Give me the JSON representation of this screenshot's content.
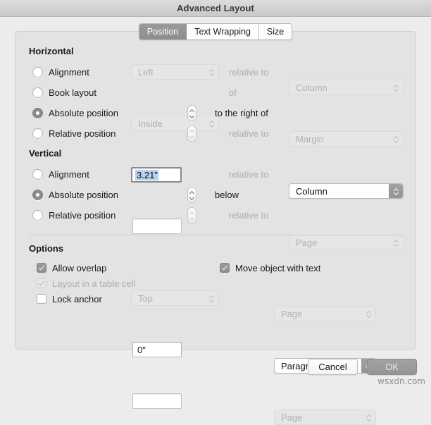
{
  "window": {
    "title": "Advanced Layout"
  },
  "tabs": [
    {
      "label": "Position",
      "active": true
    },
    {
      "label": "Text Wrapping",
      "active": false
    },
    {
      "label": "Size",
      "active": false
    }
  ],
  "horizontal": {
    "title": "Horizontal",
    "rows": [
      {
        "radio_label": "Alignment",
        "selected": false,
        "control_type": "popup",
        "control_value": "Left",
        "control_enabled": false,
        "relation_label": "relative to",
        "relation_enabled": false,
        "target_value": "Column",
        "target_enabled": false
      },
      {
        "radio_label": "Book layout",
        "selected": false,
        "control_type": "popup",
        "control_value": "Inside",
        "control_enabled": false,
        "relation_label": "of",
        "relation_enabled": false,
        "target_value": "Margin",
        "target_enabled": false
      },
      {
        "radio_label": "Absolute position",
        "selected": true,
        "control_type": "field",
        "control_value": "3.21\"",
        "control_enabled": true,
        "relation_label": "to the right of",
        "relation_enabled": true,
        "target_value": "Column",
        "target_enabled": true
      },
      {
        "radio_label": "Relative position",
        "selected": false,
        "control_type": "field",
        "control_value": "",
        "control_enabled": false,
        "relation_label": "relative to",
        "relation_enabled": false,
        "target_value": "Page",
        "target_enabled": false
      }
    ]
  },
  "vertical": {
    "title": "Vertical",
    "rows": [
      {
        "radio_label": "Alignment",
        "selected": false,
        "control_type": "popup",
        "control_value": "Top",
        "control_enabled": false,
        "relation_label": "relative to",
        "relation_enabled": false,
        "target_value": "Page",
        "target_enabled": false
      },
      {
        "radio_label": "Absolute position",
        "selected": true,
        "control_type": "field",
        "control_value": "0\"",
        "control_enabled": true,
        "relation_label": "below",
        "relation_enabled": true,
        "target_value": "Paragraph",
        "target_enabled": true
      },
      {
        "radio_label": "Relative position",
        "selected": false,
        "control_type": "field",
        "control_value": "",
        "control_enabled": false,
        "relation_label": "relative to",
        "relation_enabled": false,
        "target_value": "Page",
        "target_enabled": false
      }
    ]
  },
  "options": {
    "title": "Options",
    "left": [
      {
        "label": "Allow overlap",
        "checked": true,
        "enabled": true
      },
      {
        "label": "Layout in a table cell",
        "checked": true,
        "enabled": false
      },
      {
        "label": "Lock anchor",
        "checked": false,
        "enabled": true
      }
    ],
    "right": [
      {
        "label": "Move object with text",
        "checked": true,
        "enabled": true
      }
    ]
  },
  "footer": {
    "cancel_label": "Cancel",
    "ok_label": "OK"
  },
  "watermark": "wsxdn.com",
  "colors": {
    "window_bg": "#ececec",
    "panel_bg": "#e3e3e3",
    "accent_control": "#949494",
    "selection_highlight": "#b5d2f0",
    "disabled_text": "#aeaeae"
  }
}
